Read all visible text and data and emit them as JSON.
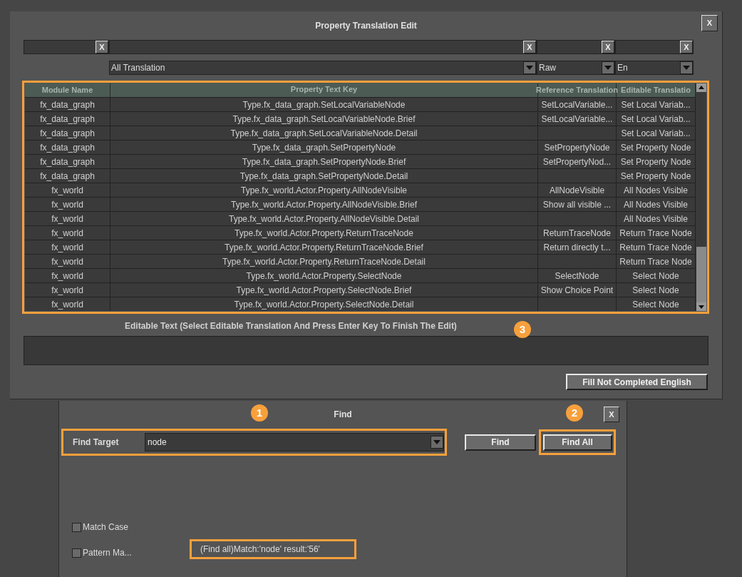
{
  "window": {
    "title": "Property Translation Edit",
    "close": "X"
  },
  "filters": [
    {
      "clear": "X"
    },
    {
      "clear": "X"
    },
    {
      "clear": "X"
    },
    {
      "clear": "X"
    }
  ],
  "dropdowns": [
    {
      "value": "All Translation"
    },
    {
      "value": "Raw"
    },
    {
      "value": "En"
    }
  ],
  "table": {
    "columns": [
      "Module Name",
      "Property Text Key",
      "Reference Translation",
      "Editable Translatio"
    ],
    "rows": [
      [
        "fx_data_graph",
        "Type.fx_data_graph.SetLocalVariableNode",
        "SetLocalVariable...",
        "Set Local Variab..."
      ],
      [
        "fx_data_graph",
        "Type.fx_data_graph.SetLocalVariableNode.Brief",
        "SetLocalVariable...",
        "Set Local Variab..."
      ],
      [
        "fx_data_graph",
        "Type.fx_data_graph.SetLocalVariableNode.Detail",
        "",
        "Set Local Variab..."
      ],
      [
        "fx_data_graph",
        "Type.fx_data_graph.SetPropertyNode",
        "SetPropertyNode",
        "Set Property Node"
      ],
      [
        "fx_data_graph",
        "Type.fx_data_graph.SetPropertyNode.Brief",
        "SetPropertyNod...",
        "Set Property Node"
      ],
      [
        "fx_data_graph",
        "Type.fx_data_graph.SetPropertyNode.Detail",
        "",
        "Set Property Node"
      ],
      [
        "fx_world",
        "Type.fx_world.Actor.Property.AllNodeVisible",
        "AllNodeVisible",
        "All Nodes Visible"
      ],
      [
        "fx_world",
        "Type.fx_world.Actor.Property.AllNodeVisible.Brief",
        "Show all visible ...",
        "All Nodes Visible"
      ],
      [
        "fx_world",
        "Type.fx_world.Actor.Property.AllNodeVisible.Detail",
        "",
        "All Nodes Visible"
      ],
      [
        "fx_world",
        "Type.fx_world.Actor.Property.ReturnTraceNode",
        "ReturnTraceNode",
        "Return Trace Node"
      ],
      [
        "fx_world",
        "Type.fx_world.Actor.Property.ReturnTraceNode.Brief",
        "Return directly t...",
        "Return Trace Node"
      ],
      [
        "fx_world",
        "Type.fx_world.Actor.Property.ReturnTraceNode.Detail",
        "",
        "Return Trace Node"
      ],
      [
        "fx_world",
        "Type.fx_world.Actor.Property.SelectNode",
        "SelectNode",
        "Select Node"
      ],
      [
        "fx_world",
        "Type.fx_world.Actor.Property.SelectNode.Brief",
        "Show Choice Point",
        "Select Node"
      ],
      [
        "fx_world",
        "Type.fx_world.Actor.Property.SelectNode.Detail",
        "",
        "Select Node"
      ]
    ]
  },
  "editable_text": {
    "label": "Editable Text (Select Editable Translation And Press Enter Key To Finish The Edit)"
  },
  "fill_button": "Fill Not Completed English",
  "find": {
    "title": "Find",
    "close": "X",
    "target_label": "Find Target",
    "target_value": "node",
    "buttons": [
      "Find",
      "Find All"
    ],
    "options": [
      {
        "label": "Match Case",
        "checked": false
      },
      {
        "label": "Pattern Ma...",
        "checked": false
      }
    ],
    "result": "(Find all)Match:'node' result:'56'"
  },
  "callouts": [
    "1",
    "2",
    "3"
  ]
}
